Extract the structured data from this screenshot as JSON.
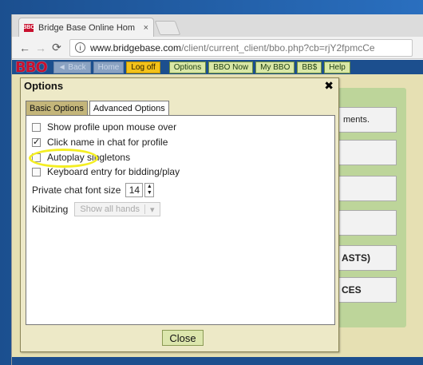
{
  "browser": {
    "tab_title": "Bridge Base Online Hom",
    "tab_close": "×",
    "favicon": "BBO",
    "url_host": "www.bridgebase.com",
    "url_path": "/client/current_client/bbo.php?cb=rjY2fpmcCe"
  },
  "bbo_toolbar": {
    "logo": "BBO",
    "back": "◄ Back",
    "home": "Home",
    "logoff": "Log off",
    "options": "Options",
    "bbo_now": "BBO Now",
    "my_bbo": "My BBO",
    "bbs": "BB$",
    "help": "Help"
  },
  "background": {
    "ghost1": "ments.",
    "ghost5": "ASTS)",
    "ghost6": "CES"
  },
  "dialog": {
    "title": "Options",
    "close_glyph": "✖",
    "tabs": [
      {
        "label": "Basic Options",
        "active": false
      },
      {
        "label": "Advanced Options",
        "active": true
      }
    ],
    "options": [
      {
        "label": "Show profile upon mouse over",
        "checked": false
      },
      {
        "label": "Click name in chat for profile",
        "checked": true
      },
      {
        "label": "Autoplay singletons",
        "checked": false
      },
      {
        "label": "Keyboard entry for bidding/play",
        "checked": false
      }
    ],
    "font_size_label": "Private chat font size",
    "font_size_value": "14",
    "kibitzing_label": "Kibitzing",
    "kibitzing_value": "Show all hands",
    "close_button": "Close"
  },
  "colors": {
    "highlight": "#f4ee22",
    "bbo_bar": "#1c4f8e",
    "logoff": "#f3c21a"
  }
}
